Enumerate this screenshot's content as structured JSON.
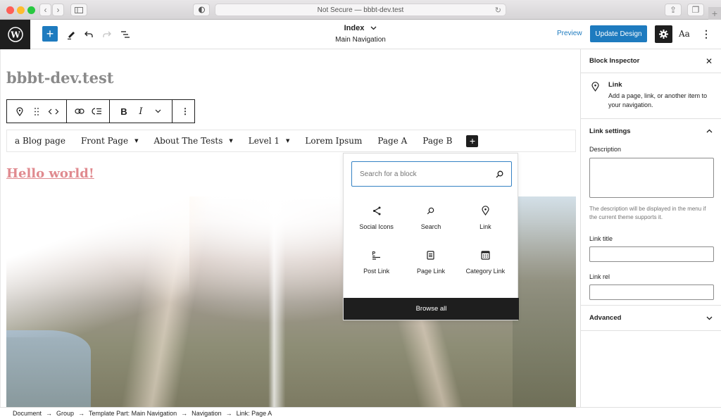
{
  "browser": {
    "url_text": "Not Secure — bbbt-dev.test",
    "traffic_colors": [
      "#fe5f57",
      "#febc2e",
      "#28c840"
    ]
  },
  "header": {
    "doc_title": "Index",
    "doc_subtitle": "Main Navigation",
    "preview_label": "Preview",
    "update_label": "Update Design",
    "styles_label": "Aa",
    "accent_color": "#1e7bbf"
  },
  "canvas": {
    "site_title": "bbbt-dev.test",
    "nav_items": [
      {
        "label": "a Blog page",
        "has_submenu": false
      },
      {
        "label": "Front Page",
        "has_submenu": true
      },
      {
        "label": "About The Tests",
        "has_submenu": true
      },
      {
        "label": "Level 1",
        "has_submenu": true
      },
      {
        "label": "Lorem Ipsum",
        "has_submenu": false
      },
      {
        "label": "Page A",
        "has_submenu": false
      },
      {
        "label": "Page B",
        "has_submenu": false
      }
    ],
    "post_title": "Hello world!"
  },
  "inserter": {
    "search_placeholder": "Search for a block",
    "blocks": [
      {
        "label": "Social Icons",
        "icon": "share-icon"
      },
      {
        "label": "Search",
        "icon": "search-icon"
      },
      {
        "label": "Link",
        "icon": "location-pin-icon"
      },
      {
        "label": "Post Link",
        "icon": "post-link-icon"
      },
      {
        "label": "Page Link",
        "icon": "page-icon"
      },
      {
        "label": "Category Link",
        "icon": "calendar-grid-icon"
      }
    ],
    "browse_all_label": "Browse all"
  },
  "sidebar": {
    "title": "Block Inspector",
    "block_name": "Link",
    "block_description": "Add a page, link, or another item to your navigation.",
    "link_settings_title": "Link settings",
    "description_label": "Description",
    "description_value": "",
    "description_help": "The description will be displayed in the menu if the current theme supports it.",
    "link_title_label": "Link title",
    "link_title_value": "",
    "link_rel_label": "Link rel",
    "link_rel_value": "",
    "advanced_title": "Advanced"
  },
  "breadcrumb": [
    "Document",
    "Group",
    "Template Part: Main Navigation",
    "Navigation",
    "Link: Page A"
  ]
}
